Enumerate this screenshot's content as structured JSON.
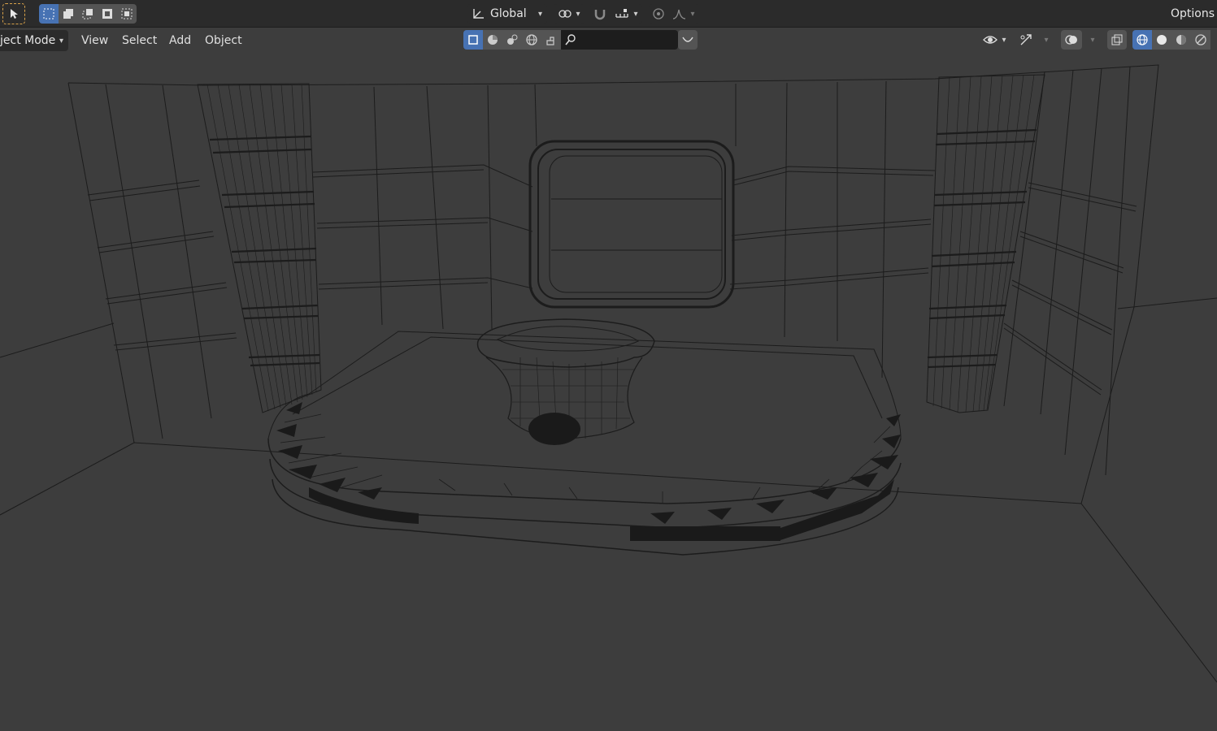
{
  "toolbar": {
    "transform_orientation": "Global",
    "options_label": "Options"
  },
  "header": {
    "mode_label": "ject Mode",
    "menus": [
      "View",
      "Select",
      "Add",
      "Object"
    ]
  },
  "viewport": {
    "shading": "wireframe",
    "colors": {
      "background": "#3d3d3d",
      "wire": "#1c1c1c",
      "accent": "#4772b3"
    }
  }
}
